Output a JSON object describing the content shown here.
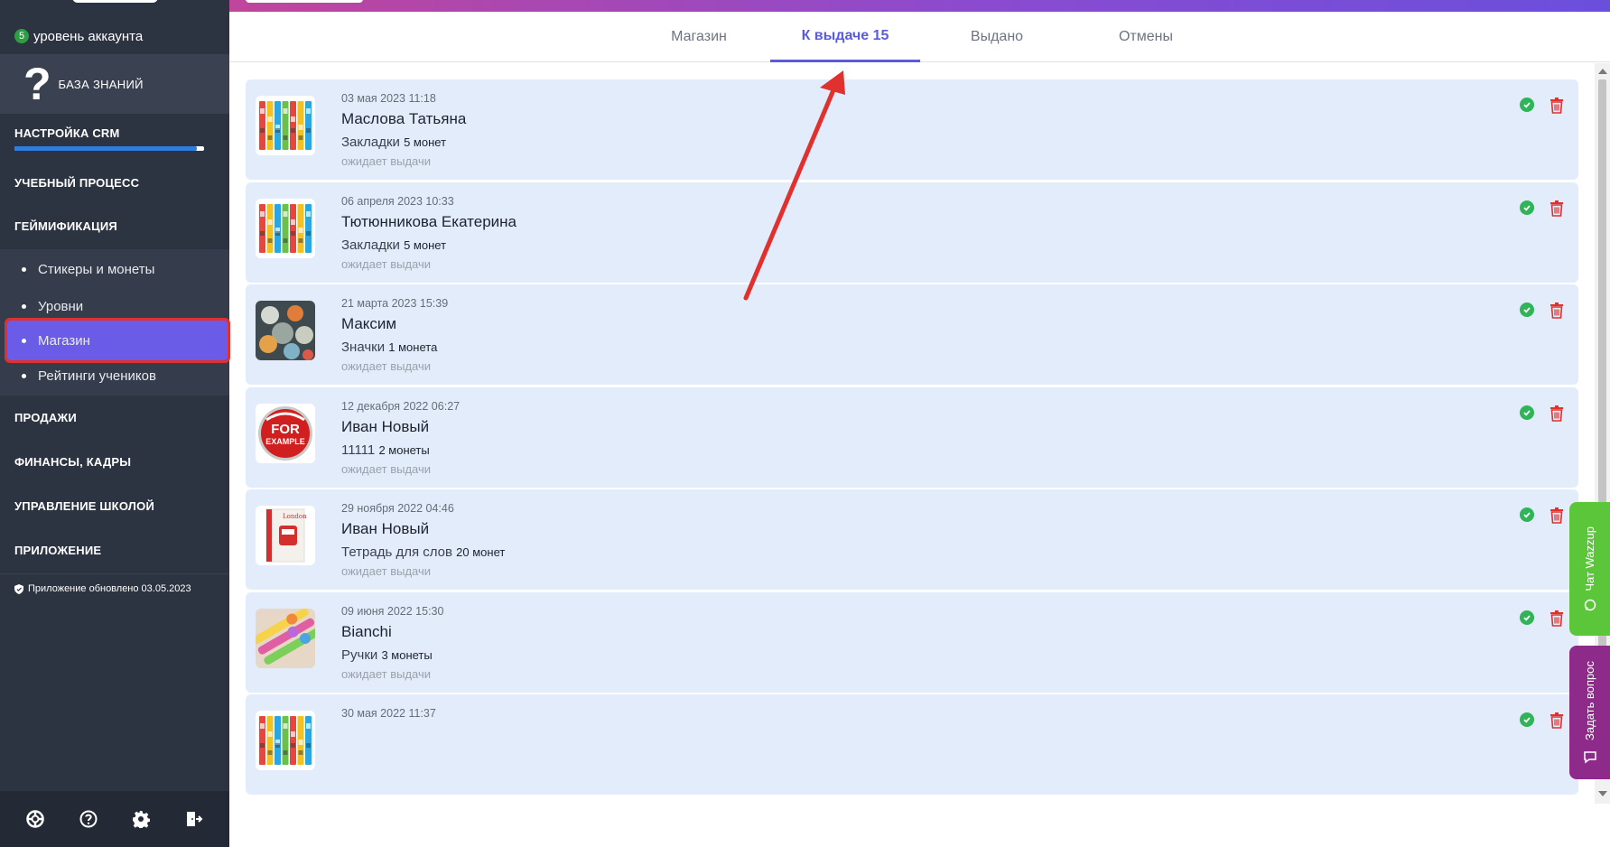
{
  "sidebar": {
    "level_badge": "5",
    "level_label": "уровень аккаунта",
    "knowledge_base": "БАЗА ЗНАНИЙ",
    "sections": {
      "crm": "НАСТРОЙКА CRM",
      "learning": "УЧЕБНЫЙ ПРОЦЕСС",
      "gamification": "ГЕЙМИФИКАЦИЯ",
      "sales": "ПРОДАЖИ",
      "finance": "ФИНАНСЫ, КАДРЫ",
      "school": "УПРАВЛЕНИЕ ШКОЛОЙ",
      "app": "ПРИЛОЖЕНИЕ"
    },
    "crm_progress": 0.96,
    "gamification_items": [
      "Стикеры и монеты",
      "Уровни",
      "Магазин",
      "Рейтинги учеников"
    ],
    "updated": "Приложение обновлено 03.05.2023",
    "bottom_icons": [
      "lifebuoy-icon",
      "help-icon",
      "gear-icon",
      "logout-icon"
    ]
  },
  "tabs": [
    "Магазин",
    "К выдаче 15",
    "Выдано",
    "Отмены"
  ],
  "active_tab": 1,
  "orders": [
    {
      "date": "03 мая 2023 11:18",
      "name": "Маслова Татьяна",
      "item": "Закладки",
      "coins": "5 монет",
      "status": "ожидает выдачи",
      "thumb": "bookmarks"
    },
    {
      "date": "06 апреля 2023 10:33",
      "name": "Тютюнникова Екатерина",
      "item": "Закладки",
      "coins": "5 монет",
      "status": "ожидает выдачи",
      "thumb": "bookmarks"
    },
    {
      "date": "21 марта 2023 15:39",
      "name": "Максим",
      "item": "Значки",
      "coins": "1 монета",
      "status": "ожидает выдачи",
      "thumb": "badges"
    },
    {
      "date": "12 декабря 2022 06:27",
      "name": "Иван Новый",
      "item": "11111",
      "coins": "2 монеты",
      "status": "ожидает выдачи",
      "thumb": "example"
    },
    {
      "date": "29 ноября 2022 04:46",
      "name": "Иван Новый",
      "item": "Тетрадь для слов",
      "coins": "20 монет",
      "status": "ожидает выдачи",
      "thumb": "notebook"
    },
    {
      "date": "09 июня 2022 15:30",
      "name": "Bianchi",
      "item": "Ручки",
      "coins": "3 монеты",
      "status": "ожидает выдачи",
      "thumb": "pens"
    },
    {
      "date": "30 мая 2022 11:37",
      "name": "",
      "item": "",
      "coins": "",
      "status": "",
      "thumb": "bookmarks"
    }
  ],
  "thumb_labels": {
    "example_top": "FOR",
    "example_bottom": "EXAMPLE"
  },
  "widgets": {
    "wazzup": "Чат Wazzup",
    "question": "Задать вопрос"
  },
  "colors": {
    "accent": "#5b5be0",
    "sidebar": "#2c3341",
    "card": "#e2ecfb",
    "ok": "#2fb457",
    "delete": "#e0312e",
    "wazzup": "#5cc63a",
    "question": "#8e2a8a"
  }
}
